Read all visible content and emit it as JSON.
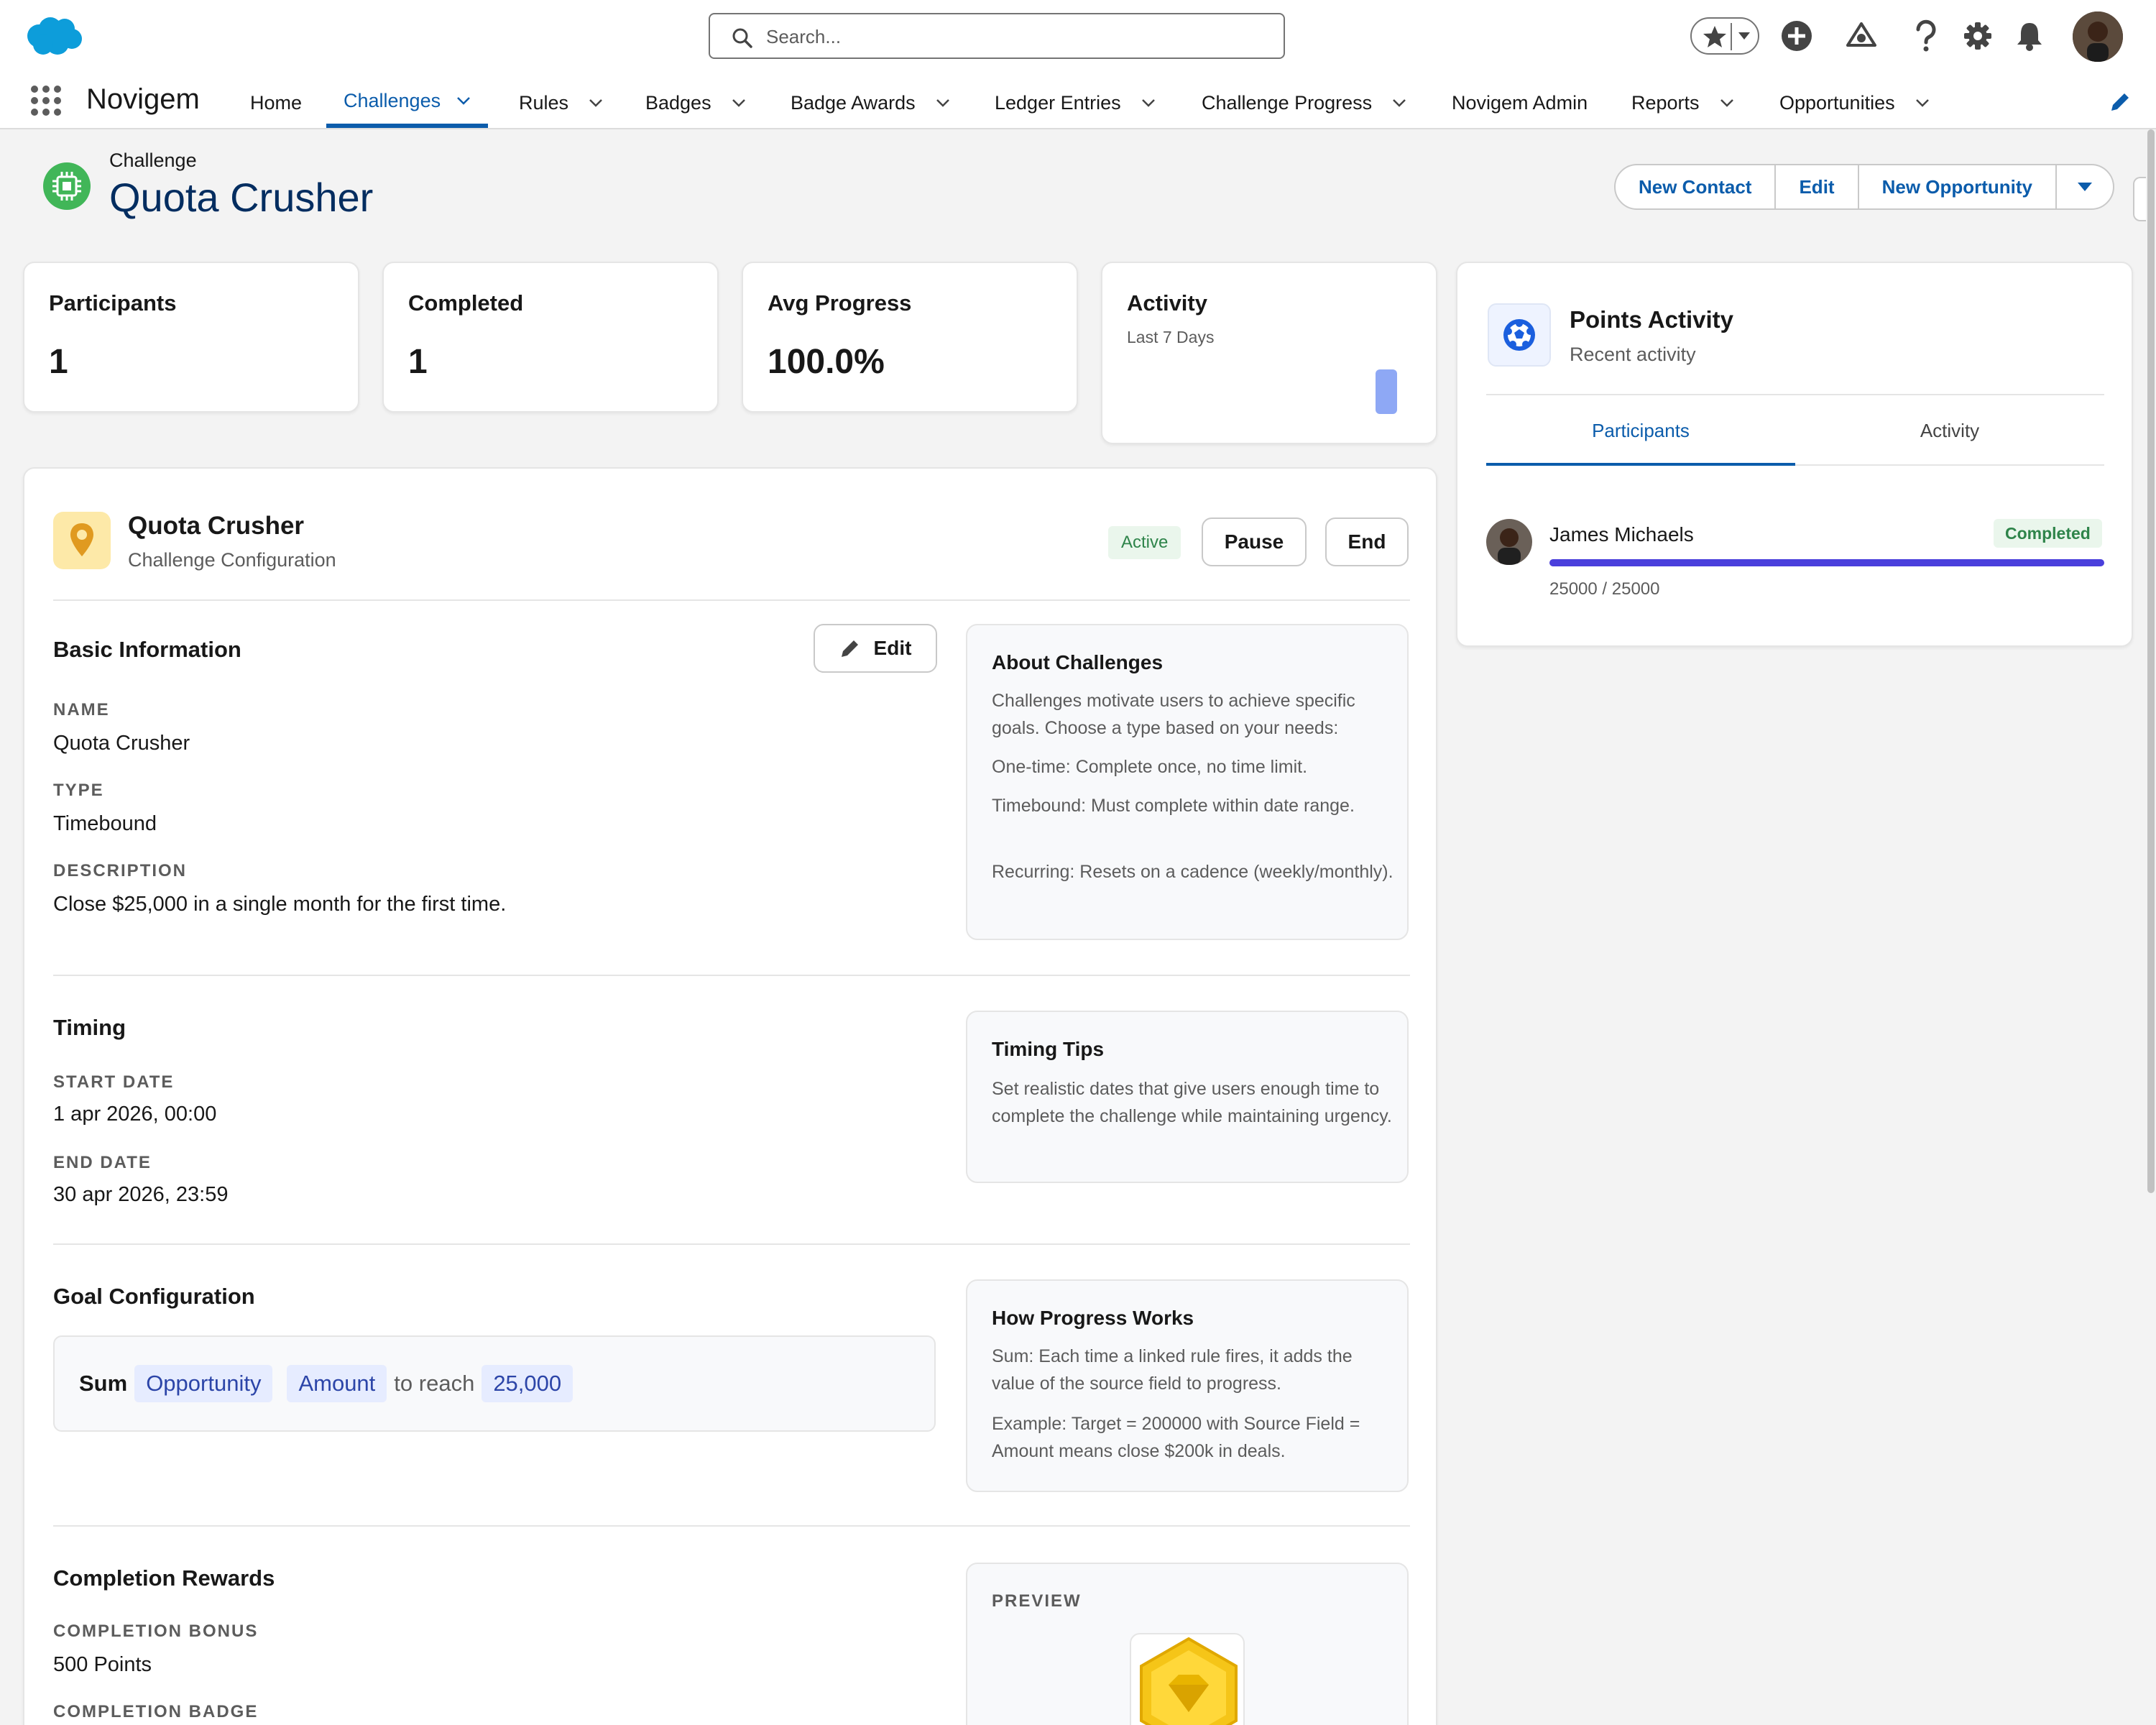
{
  "header": {
    "search_placeholder": "Search...",
    "app_name": "Novigem",
    "nav": [
      {
        "label": "Home",
        "dropdown": false
      },
      {
        "label": "Challenges",
        "dropdown": true,
        "selected": true
      },
      {
        "label": "Rules",
        "dropdown": true
      },
      {
        "label": "Badges",
        "dropdown": true
      },
      {
        "label": "Badge Awards",
        "dropdown": true
      },
      {
        "label": "Ledger Entries",
        "dropdown": true
      },
      {
        "label": "Challenge Progress",
        "dropdown": true
      },
      {
        "label": "Novigem Admin",
        "dropdown": false
      },
      {
        "label": "Reports",
        "dropdown": true
      },
      {
        "label": "Opportunities",
        "dropdown": true
      }
    ],
    "icons": [
      "favorites-star-icon",
      "add-icon",
      "trailhead-icon",
      "help-icon",
      "setup-gear-icon",
      "notifications-bell-icon"
    ]
  },
  "record": {
    "type": "Challenge",
    "title": "Quota Crusher",
    "actions": [
      "New Contact",
      "Edit",
      "New Opportunity"
    ]
  },
  "stats": {
    "participants": {
      "label": "Participants",
      "value": "1"
    },
    "completed": {
      "label": "Completed",
      "value": "1"
    },
    "avg_progress": {
      "label": "Avg Progress",
      "value": "100.0%"
    },
    "activity": {
      "label": "Activity",
      "subtitle": "Last 7 Days"
    }
  },
  "config": {
    "title": "Quota Crusher",
    "subtitle": "Challenge Configuration",
    "status": "Active",
    "pause": "Pause",
    "end": "End",
    "basic": {
      "heading": "Basic Information",
      "edit": "Edit",
      "name_label": "NAME",
      "name": "Quota Crusher",
      "type_label": "TYPE",
      "type": "Timebound",
      "desc_label": "DESCRIPTION",
      "desc": "Close $25,000 in a single month for the first time."
    },
    "about": {
      "title": "About Challenges",
      "p1": "Challenges motivate users to achieve specific goals. Choose a type based on your needs:",
      "p2": "One-time: Complete once, no time limit.",
      "p3": "Timebound: Must complete within date range.",
      "p4": "Recurring: Resets on a cadence (weekly/monthly)."
    },
    "timing": {
      "heading": "Timing",
      "start_label": "START DATE",
      "start": "1 apr 2026, 00:00",
      "end_label": "END DATE",
      "end": "30 apr 2026, 23:59"
    },
    "timing_tips": {
      "title": "Timing Tips",
      "p1": "Set realistic dates that give users enough time to complete the challenge while maintaining urgency."
    },
    "goal": {
      "heading": "Goal Configuration",
      "agg": "Sum",
      "object": "Opportunity",
      "field": "Amount",
      "mid": "to reach",
      "target": "25,000"
    },
    "progress": {
      "title": "How Progress Works",
      "p1": "Sum: Each time a linked rule fires, it adds the value of the source field to progress.",
      "p2": "Example: Target = 200000 with Source Field = Amount means close $200k in deals."
    },
    "rewards": {
      "heading": "Completion Rewards",
      "bonus_label": "COMPLETION BONUS",
      "bonus": "500 Points",
      "badge_label": "COMPLETION BADGE",
      "preview_label": "PREVIEW"
    }
  },
  "points": {
    "title": "Points Activity",
    "subtitle": "Recent activity",
    "tabs": [
      "Participants",
      "Activity"
    ],
    "participant": {
      "name": "James Michaels",
      "status": "Completed",
      "progress_text": "25000 / 25000",
      "progress_fraction": 1.0
    }
  },
  "colors": {
    "brand": "#0b5cab",
    "progress": "#4a3fdc",
    "status_green": "#2e844a"
  }
}
